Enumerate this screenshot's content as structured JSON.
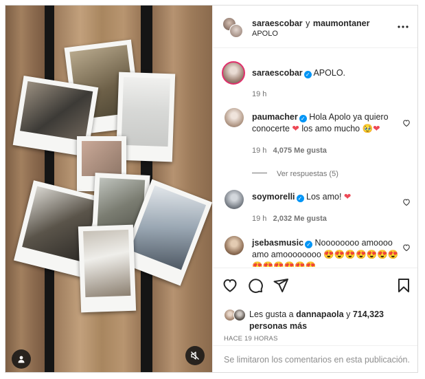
{
  "header": {
    "author1": "saraescobar",
    "connector": "y",
    "author2": "maumontaner",
    "subtitle": "APOLO",
    "more_icon": "more-horizontal-icon"
  },
  "caption": {
    "username": "saraescobar",
    "text": "APOLO.",
    "time": "19 h"
  },
  "comments": [
    {
      "username": "paumacher",
      "text": "Hola Apolo ya quiero conocerte",
      "text_end": " los amo mucho 🥹",
      "time": "19 h",
      "likes": "4,075 Me gusta",
      "replies": "Ver respuestas (5)"
    },
    {
      "username": "soymorelli",
      "text": "Los amo!",
      "time": "19 h",
      "likes": "2,032 Me gusta"
    },
    {
      "username": "jsebasmusic",
      "text": "Noooooooo amoooo amo amoooooooo",
      "emojis": "😍😍😍😍😍😍😍😍😍😍😍😍😍"
    }
  ],
  "actions": {
    "like_icon": "heart-icon",
    "comment_icon": "comment-icon",
    "share_icon": "send-icon",
    "save_icon": "bookmark-icon"
  },
  "likes": {
    "prefix": "Les gusta a",
    "user": "dannapaola",
    "connector": "y",
    "count": "714,323 personas más"
  },
  "timestamp": "HACE 19 HORAS",
  "footer": {
    "text": "Se limitaron los comentarios en esta publicación."
  },
  "colors": {
    "verified": "#0095f6",
    "heart": "#ed4956",
    "muted": "#737373",
    "border": "#dbdbdb"
  }
}
